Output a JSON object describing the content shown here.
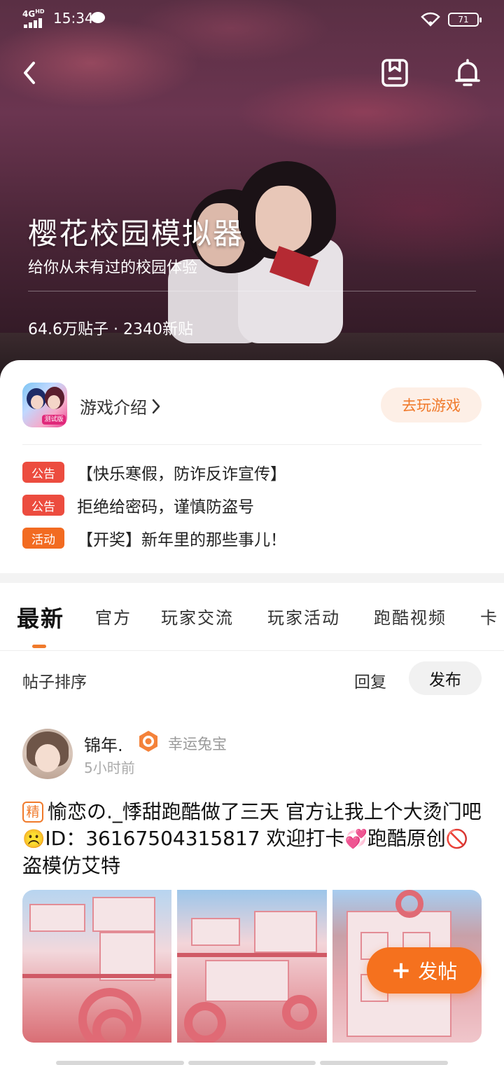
{
  "status_bar": {
    "network": "4G",
    "network_sup": "HD",
    "time": "15:34",
    "battery": "71"
  },
  "header": {
    "title": "樱花校园模拟器",
    "subtitle": "给你从未有过的校园体验",
    "stats": "64.6万贴子 · 2340新贴"
  },
  "game": {
    "icon_tag": "测试版",
    "intro_label": "游戏介绍",
    "play_button": "去玩游戏"
  },
  "notices": [
    {
      "badge": "公告",
      "color": "#ec4c3f",
      "text": "【快乐寒假，防诈反诈宣传】"
    },
    {
      "badge": "公告",
      "color": "#ec4c3f",
      "text": "拒绝给密码，谨慎防盗号"
    },
    {
      "badge": "活动",
      "color": "#f26b21",
      "text": "【开奖】新年里的那些事儿！"
    }
  ],
  "tabs": [
    "最新",
    "官方",
    "玩家交流",
    "玩家活动",
    "跑酷视频",
    "卡"
  ],
  "sort": {
    "label": "帖子排序",
    "reply": "回复",
    "publish": "发布"
  },
  "post": {
    "author": "锦年.",
    "badge_text": "幸运兔宝",
    "time": "5小时前",
    "tag": "精",
    "text_part1": "愉恋の._悸甜跑酷做了三天 官方让我上个大烫门吧",
    "emoji1": "☹️",
    "text_part2": "ID：36167504315817 欢迎打卡",
    "emoji2": "💞",
    "text_part3": "跑酷原创",
    "emoji3": "🚫",
    "text_part4": "盗模仿艾特"
  },
  "fab": {
    "icon": "+",
    "label": "发帖"
  },
  "colors": {
    "accent": "#f5711e",
    "play_bg": "#fdefe6",
    "notice_red": "#ec4c3f",
    "activity_orange": "#f26b21"
  }
}
